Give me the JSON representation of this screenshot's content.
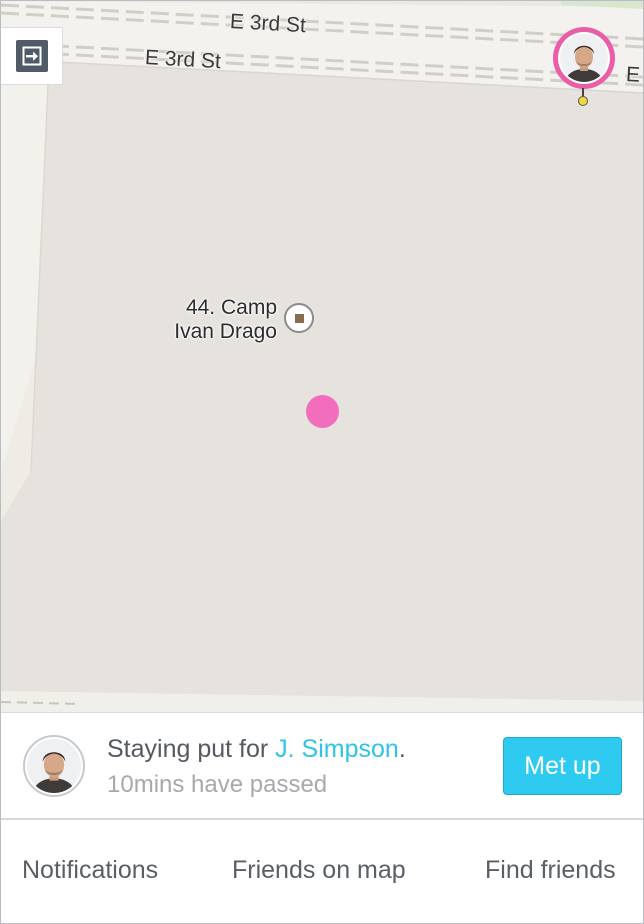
{
  "map": {
    "streets": [
      "E 3rd St",
      "E 3rd St",
      "E"
    ],
    "poi": {
      "line1": "44. Camp",
      "line2": "Ivan Drago",
      "icon": "landmark-marker-icon"
    },
    "icons": {
      "exit": "exit-icon",
      "friend_pin": "friend-location-pin-icon",
      "me": "current-location-dot-icon"
    },
    "colors": {
      "land": "#e6e3de",
      "road": "#f4f2ee",
      "me_dot": "#f26dbb",
      "pin_ring": "#e95ea8"
    }
  },
  "status": {
    "prefix": "Staying put for ",
    "friend_name": "J. Simpson",
    "suffix": ".",
    "elapsed": "10mins have passed",
    "button_label": "Met up",
    "button_color": "#2fcaf0",
    "link_color": "#2ec4e6"
  },
  "nav": {
    "items": [
      {
        "label": "Notifications"
      },
      {
        "label": "Friends on map"
      },
      {
        "label": "Find friends"
      }
    ]
  }
}
